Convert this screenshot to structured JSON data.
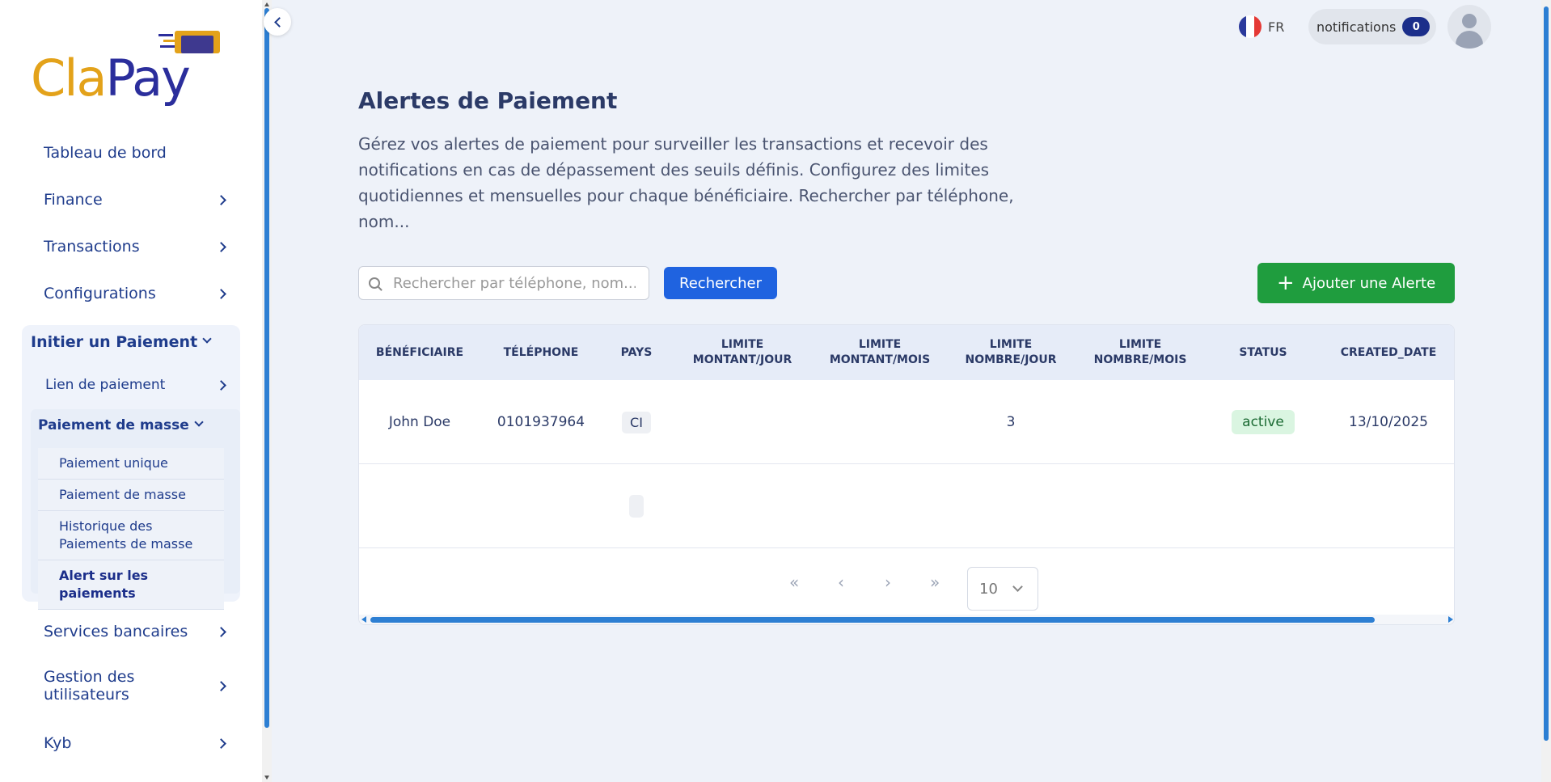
{
  "brand": {
    "name_part1": "Cla",
    "name_part2": "Pay",
    "color_primary": "#e3a21a",
    "color_secondary": "#2b2e9c"
  },
  "sidebar": {
    "items": [
      {
        "label": "Tableau de bord",
        "has_chevron": false
      },
      {
        "label": "Finance",
        "has_chevron": true
      },
      {
        "label": "Transactions",
        "has_chevron": true
      },
      {
        "label": "Configurations",
        "has_chevron": true
      }
    ],
    "expanded": {
      "label": "Initier un Paiement",
      "link": "Lien de paiement",
      "group": {
        "label": "Paiement de masse",
        "leaves": [
          "Paiement unique",
          "Paiement de masse",
          "Historique des Paiements de masse",
          "Alert sur les paiements"
        ]
      }
    },
    "items_after": [
      {
        "label": "Services bancaires"
      },
      {
        "label": "Gestion des utilisateurs"
      },
      {
        "label": "Kyb"
      }
    ]
  },
  "topbar": {
    "lang": "FR",
    "notifications_label": "notifications",
    "notifications_count": "0"
  },
  "main": {
    "title": "Alertes de Paiement",
    "description": "Gérez vos alertes de paiement pour surveiller les transactions et recevoir des notifications en cas de dépassement des seuils définis. Configurez des limites quotidiennes et mensuelles pour chaque bénéficiaire. Rechercher par téléphone, nom...",
    "search_placeholder": "Rechercher par téléphone, nom...",
    "search_button": "Rechercher",
    "add_button": "Ajouter une Alerte"
  },
  "table": {
    "columns": [
      "BÉNÉFICIAIRE",
      "TÉLÉPHONE",
      "PAYS",
      "LIMITE MONTANT/JOUR",
      "LIMITE MONTANT/MOIS",
      "LIMITE NOMBRE/JOUR",
      "LIMITE NOMBRE/MOIS",
      "STATUS",
      "CREATED_DATE"
    ],
    "rows": [
      {
        "beneficiaire": "John Doe",
        "telephone": "0101937964",
        "pays": "CI",
        "limite_montant_jour": "",
        "limite_montant_mois": "",
        "limite_nombre_jour": "3",
        "limite_nombre_mois": "",
        "status": "active",
        "created_date": "13/10/2025"
      }
    ],
    "page_size": "10"
  },
  "icons": {
    "first": "«",
    "prev": "‹",
    "next": "›",
    "last": "»"
  }
}
